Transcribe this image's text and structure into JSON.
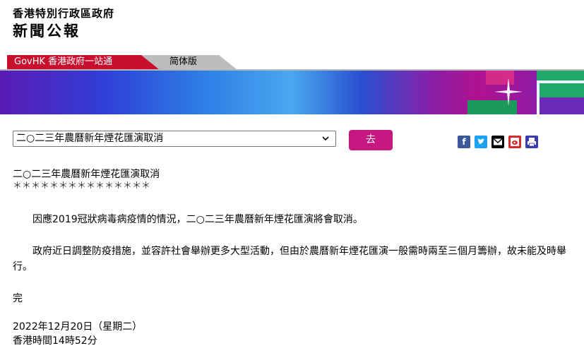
{
  "masthead": {
    "government": "香港特別行政區政府",
    "publication": "新聞公報"
  },
  "nav": {
    "govhk_tab": "GovHK 香港政府一站通",
    "simplified_tab": "简体版"
  },
  "toolbar": {
    "selected_article": "二○二三年農曆新年煙花匯演取消",
    "go_label": "去",
    "share_icons": [
      "facebook-icon",
      "twitter-icon",
      "email-icon",
      "weibo-icon",
      "print-icon"
    ]
  },
  "article": {
    "title": "二○二三年農曆新年煙花匯演取消",
    "underline": "＊＊＊＊＊＊＊＊＊＊＊＊＊＊＊",
    "paragraphs": [
      "因應2019冠狀病毒病疫情的情況，二○二三年農曆新年煙花匯演將會取消。",
      "政府近日調整防疫措施，並容許社會舉辦更多大型活動，但由於農曆新年煙花匯演一般需時兩至三個月籌辦，故未能及時舉行。"
    ],
    "end_mark": "完",
    "date": "2022年12月20日（星期二）",
    "time": "香港時間14時52分"
  },
  "colors": {
    "govhk_red": "#c8102e",
    "go_button": "#c71781"
  }
}
